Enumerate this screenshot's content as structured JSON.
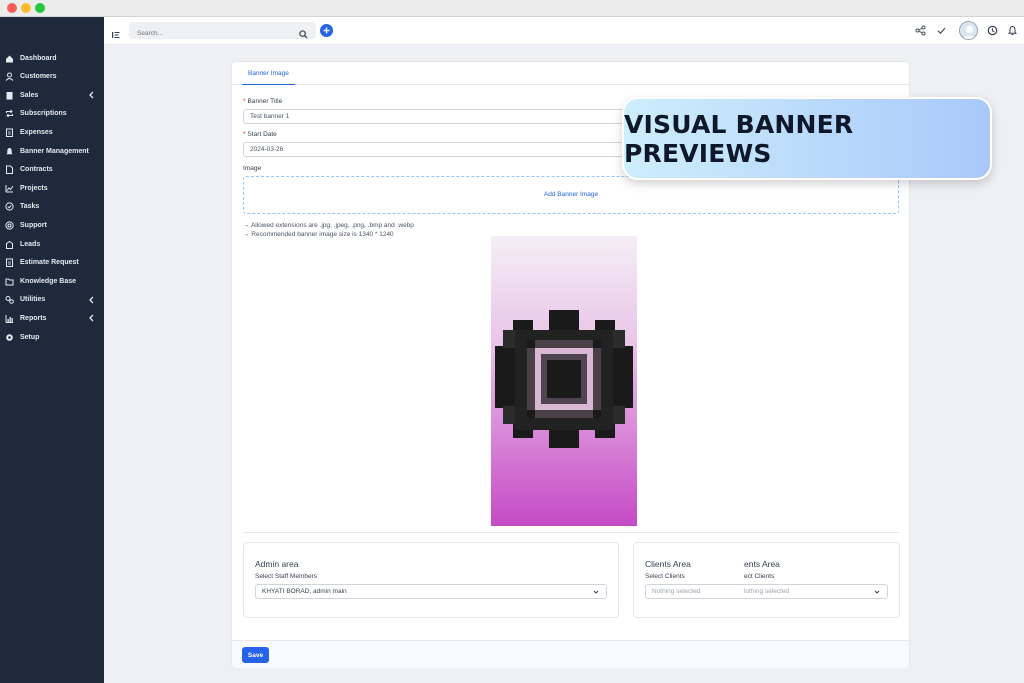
{
  "sidebar": {
    "items": [
      {
        "label": "Dashboard",
        "icon": "home-icon",
        "has_children": false
      },
      {
        "label": "Customers",
        "icon": "user-icon",
        "has_children": false
      },
      {
        "label": "Sales",
        "icon": "file-icon",
        "has_children": true
      },
      {
        "label": "Subscriptions",
        "icon": "repeat-icon",
        "has_children": false
      },
      {
        "label": "Expenses",
        "icon": "file-text-icon",
        "has_children": false
      },
      {
        "label": "Banner Management",
        "icon": "bell-icon",
        "has_children": false
      },
      {
        "label": "Contracts",
        "icon": "document-icon",
        "has_children": false
      },
      {
        "label": "Projects",
        "icon": "chart-icon",
        "has_children": false
      },
      {
        "label": "Tasks",
        "icon": "check-circle-icon",
        "has_children": false
      },
      {
        "label": "Support",
        "icon": "lifebuoy-icon",
        "has_children": false
      },
      {
        "label": "Leads",
        "icon": "building-icon",
        "has_children": false
      },
      {
        "label": "Estimate Request",
        "icon": "file-text-icon",
        "has_children": false
      },
      {
        "label": "Knowledge Base",
        "icon": "folder-icon",
        "has_children": false
      },
      {
        "label": "Utilities",
        "icon": "gears-icon",
        "has_children": true
      },
      {
        "label": "Reports",
        "icon": "bar-chart-icon",
        "has_children": true
      },
      {
        "label": "Setup",
        "icon": "gear-icon",
        "has_children": false
      }
    ]
  },
  "topbar": {
    "search_placeholder": "Search..."
  },
  "form": {
    "tab_label": "Banner Image",
    "banner_title_label": "Banner Title",
    "banner_title_value": "Test banner 1",
    "start_date_label": "Start Date",
    "start_date_value": "2024-03-26",
    "image_label": "Image",
    "add_image_label": "Add Banner Image",
    "hint_extensions": "→ Allowed extensions are .jpg, .jpeg, .png, .bmp and .webp",
    "hint_size": "→ Recommended banner image size is 1340 * 1240"
  },
  "admin_area": {
    "title": "Admin area",
    "select_label": "Select Staff Members",
    "selected_value": "KHYATI BORAD, admin main"
  },
  "clients_area": {
    "title": "Clients Area",
    "title_ghost": "ents Area",
    "select_label": "Select Clients",
    "select_label_ghost": "ect Clients",
    "placeholder": "Nothing selected",
    "placeholder_ghost": "lothing selected"
  },
  "footer": {
    "save_label": "Save"
  },
  "overlay": {
    "text": "VISUAL BANNER PREVIEWS"
  },
  "colors": {
    "sidebar_bg": "#1e2a3b",
    "accent": "#2563eb",
    "banner_gradient_top": "#f5eef6",
    "banner_gradient_bottom": "#c54bc6"
  }
}
